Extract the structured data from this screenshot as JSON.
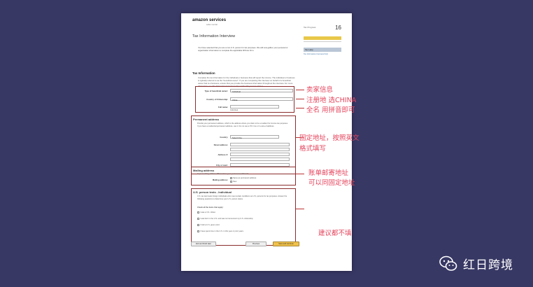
{
  "document": {
    "logo": "amazon services",
    "logo_sub": "seller central",
    "page_title": "Tax Information Interview",
    "steps_label": "Tax Progress",
    "steps_count": "16",
    "help_label": "Tax Help",
    "side_link": "Tax Information Interview FAQ",
    "intro_text": "You have selected that you are a non-U.S. person for tax purposes. We will now gather your personal or organization information to complete the applicable IRS tax form.",
    "tax_info_heading": "Tax Information",
    "tax_info_text": "Complete the tax information for the individual or business that will report the income. The individual or business is typically referred to as the \"beneficial owner\". If you are completing this interview on behalf of a beneficial owner that is a business, ensure that you provide the business information throughout the interview. For more information, see Tax Information Interview Help or talk with your tax advisor.",
    "fields": {
      "beneficial_owner_label": "Type of beneficial owner:",
      "beneficial_owner_value": "Individual",
      "citizenship_label": "Country of Citizenship:",
      "citizenship_value": "China",
      "fullname_label": "Full name:",
      "fullname_hint": "Individual"
    },
    "permanent_address": {
      "heading": "Permanent address",
      "text": "Provide your permanent address, which is the address where you claim to be a resident for income tax purposes. If you have a residential permanent address, use it. Do not use a P.O. box or in-care-of address.",
      "country_label": "Country:",
      "country_value": "Select One",
      "street_label": "Street address:",
      "address2_label": "Address 2:",
      "city_label": "City or town:"
    },
    "mailing_address": {
      "heading": "Mailing address",
      "question": "Is your mailing address different from your permanent address?",
      "label": "Mailing address:",
      "option_same": "Same as permanent address",
      "option_new": "New"
    },
    "us_person": {
      "heading": "U.S. person tests - Individual",
      "text": "U.S. tax law treats foreign individuals who meet certain conditions as U.S. persons for tax purposes. Answer the following questions to determine your U.S. person status.",
      "check_label": "Check all the items that apply:",
      "items": [
        "I was a U.S. citizen.",
        "I was born in the U.S. and was not renounced my U.S. citizenship.",
        "I hold a U.S. green card.",
        "I have spent time in the U.S. in this year or prior years."
      ]
    },
    "buttons": {
      "exit": "Exit and finish later",
      "previous": "Previous",
      "save": "Save and continue"
    }
  },
  "annotations": {
    "seller_info": "卖家信息",
    "register_country": "注册地 选CHINA",
    "full_name": "全名 用拼音即可",
    "permanent_address": "固定地址，按照英文",
    "format": "格式填写",
    "mailing": "账单邮寄地址",
    "mailing_same": "可以同固定地址",
    "suggest": "建议都不填"
  },
  "watermark": {
    "text": "红日跨境",
    "icon": "wechat-icon"
  },
  "colors": {
    "background": "#383865",
    "annotation": "#e5455d",
    "box_border": "#8b2c2c"
  }
}
